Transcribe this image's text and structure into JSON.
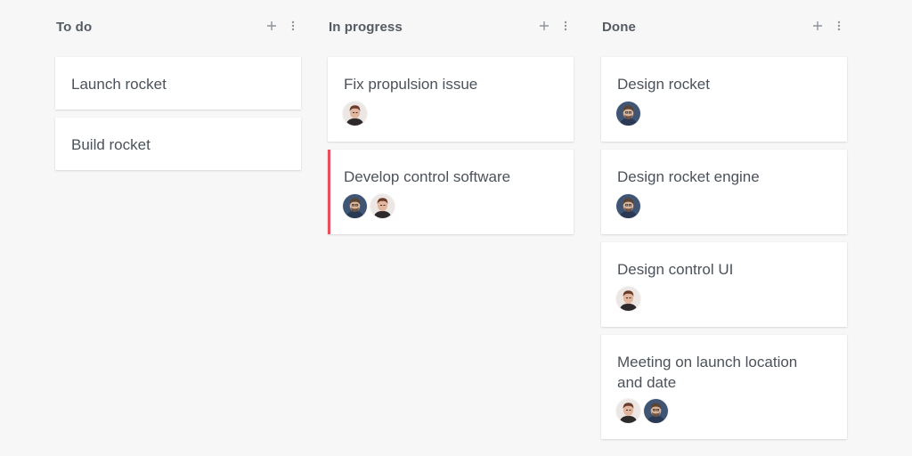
{
  "columns": [
    {
      "title": "To do",
      "cards": [
        {
          "title": "Launch rocket",
          "avatars": []
        },
        {
          "title": "Build rocket",
          "avatars": []
        }
      ]
    },
    {
      "title": "In progress",
      "cards": [
        {
          "title": "Fix propulsion issue",
          "avatars": [
            "person-a"
          ]
        },
        {
          "title": "Develop control software",
          "avatars": [
            "person-b",
            "person-a"
          ],
          "flagged": true
        }
      ]
    },
    {
      "title": "Done",
      "cards": [
        {
          "title": "Design rocket",
          "avatars": [
            "person-b"
          ]
        },
        {
          "title": "Design rocket engine",
          "avatars": [
            "person-b"
          ]
        },
        {
          "title": "Design control UI",
          "avatars": [
            "person-a"
          ]
        },
        {
          "title": "Meeting on launch location and date",
          "avatars": [
            "person-a",
            "person-b"
          ]
        }
      ]
    }
  ],
  "icons": {
    "add": "plus-icon",
    "more": "more-vertical-icon"
  },
  "colors": {
    "flag": "#e8505e",
    "title": "#555b63",
    "text": "#4c525a",
    "background": "#f7f7f7"
  }
}
